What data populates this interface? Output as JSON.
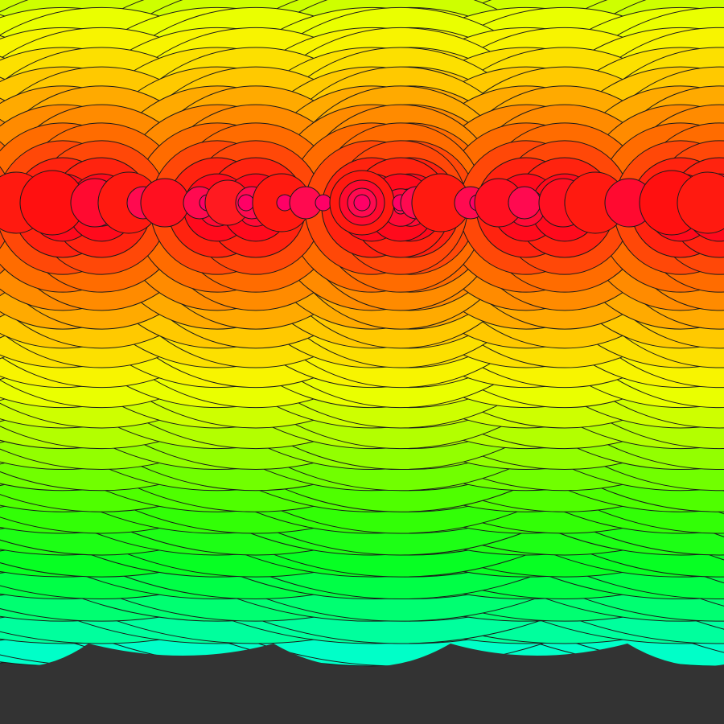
{
  "canvas": {
    "background": "#333333",
    "stroke": "#1a1a1a"
  },
  "artwork": {
    "type": "concentric-circle-pattern",
    "description_colors": {
      "top": "#ff0a1a",
      "orange": "#ff8c00",
      "yellow": "#ffff00",
      "lime": "#b4ff00",
      "green": "#00ff22",
      "bottom": "#00ffc0",
      "small_accent": "#ff0066"
    }
  }
}
